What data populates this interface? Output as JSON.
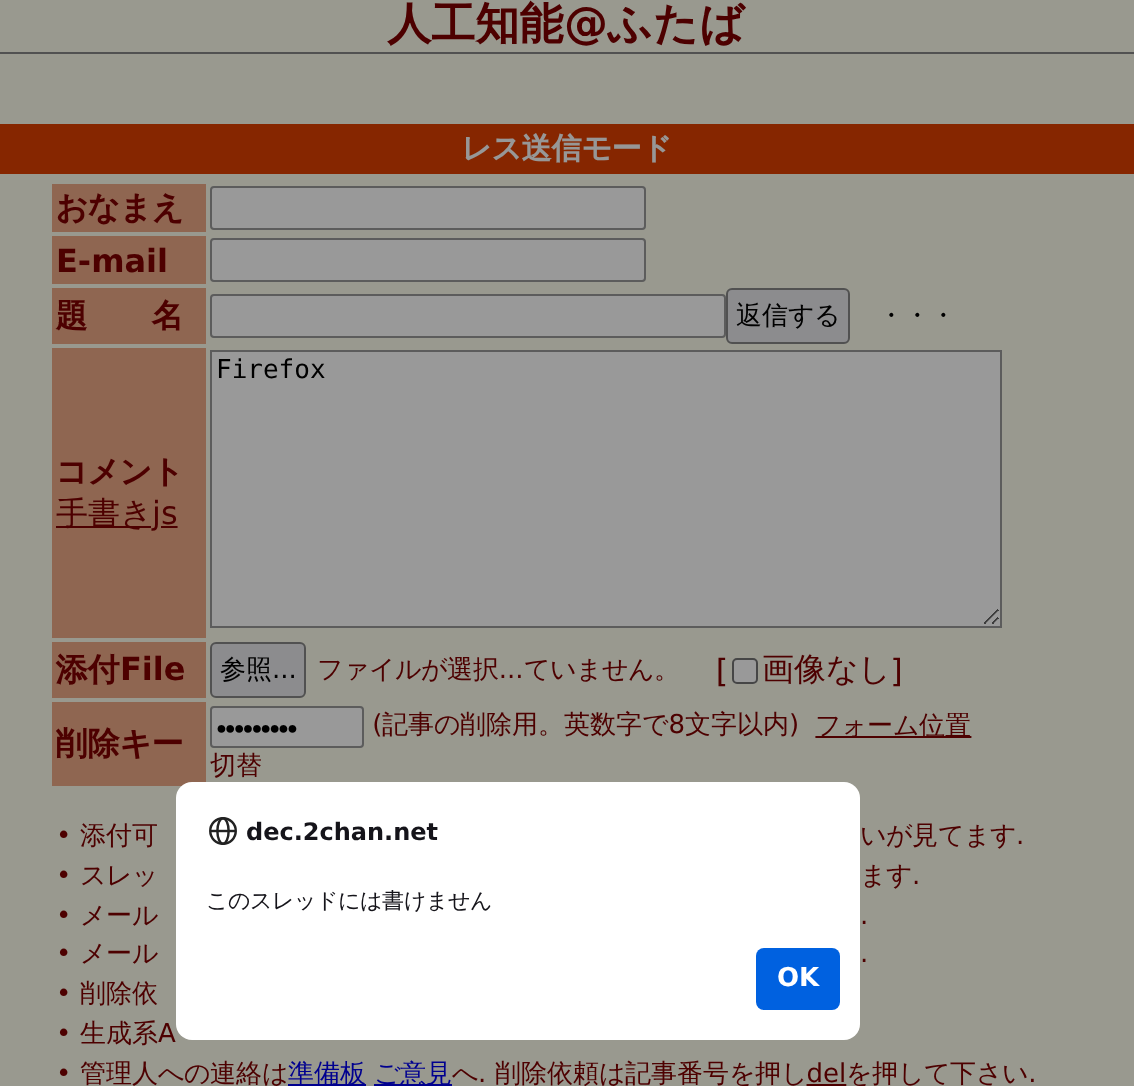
{
  "site_title": "人工知能@ふたば",
  "mode_banner": "レス送信モード",
  "form": {
    "name": {
      "label": "おなまえ"
    },
    "email": {
      "label": "E-mail"
    },
    "subject": {
      "label": "題　　名",
      "submit": "返信する",
      "dots": "・・・"
    },
    "comment": {
      "label": "コメント",
      "link": "手書きjs",
      "value": "Firefox"
    },
    "file": {
      "label": "添付File",
      "browse": "参照...",
      "status": "ファイルが選択...ていません。",
      "open": "[",
      "close": "]",
      "no_image": {
        "label": "画像なし",
        "checked": false
      }
    },
    "delete_key": {
      "label": "削除キー",
      "value": "●●●●●●●●●",
      "note": "(記事の削除用。英数字で8文字以内)",
      "link": "フォーム位置",
      "after": "切替"
    }
  },
  "notes": [
    {
      "marker": "•",
      "start": "添付可",
      "end": "いが見てます."
    },
    {
      "marker": "•",
      "start": "スレッ",
      "end": "ます."
    },
    {
      "marker": "•",
      "start": "メール",
      "end": "."
    },
    {
      "marker": "•",
      "start": "メール",
      "end": "."
    },
    {
      "marker": "•",
      "start": "削除依"
    },
    {
      "marker": "•",
      "start": "生成系A"
    }
  ],
  "contact": {
    "marker": "•",
    "parts": [
      {
        "kind": "text",
        "text": "管理人への連絡は"
      },
      {
        "kind": "link",
        "text": "準備板"
      },
      {
        "kind": "link",
        "text": "ご意見"
      },
      {
        "kind": "text",
        "text": "へ. 削除依頼は記事番号を押し"
      },
      {
        "kind": "dellink",
        "text": "del"
      },
      {
        "kind": "text",
        "text": "を押して下さい."
      }
    ]
  },
  "dialog": {
    "origin": "dec.2chan.net",
    "message": "このスレッドには書けません",
    "button": "OK"
  }
}
